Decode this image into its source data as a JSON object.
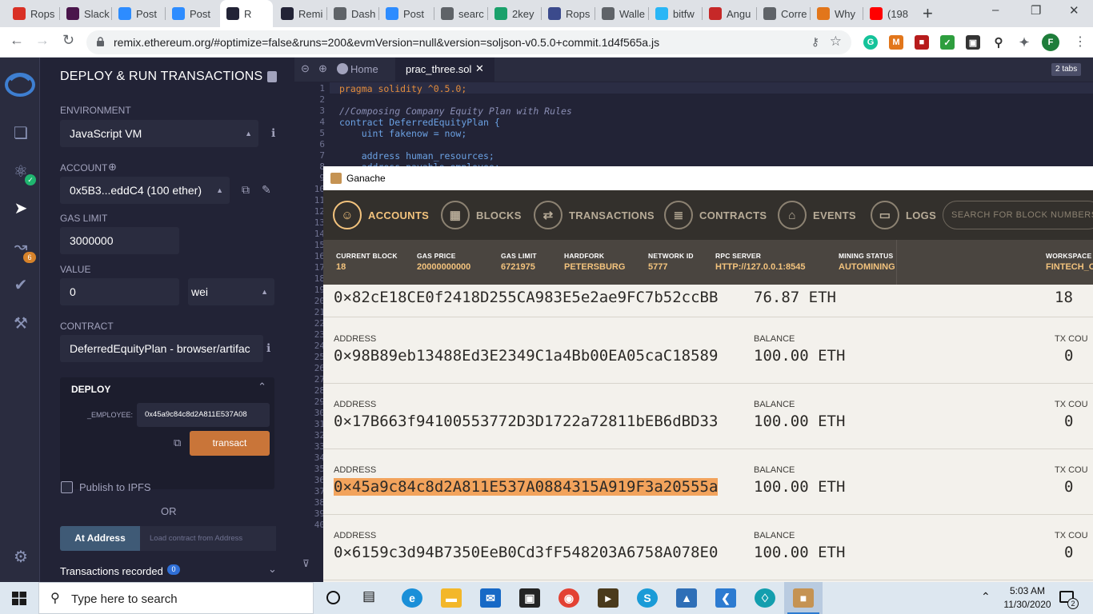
{
  "browser": {
    "tabs": [
      {
        "label": "Rops",
        "icon": "gmail-icon",
        "color": "#d93025"
      },
      {
        "label": "Slack",
        "icon": "slack-icon",
        "color": "#4a154b"
      },
      {
        "label": "Post",
        "icon": "zoom-icon",
        "color": "#2d8cff"
      },
      {
        "label": "Post",
        "icon": "zoom-icon",
        "color": "#2d8cff"
      },
      {
        "label": "R",
        "icon": "remix-icon",
        "color": "#222336"
      },
      {
        "label": "Remi",
        "icon": "remix-icon",
        "color": "#222336"
      },
      {
        "label": "Dash",
        "icon": "globe-icon",
        "color": "#5f6368"
      },
      {
        "label": "Post",
        "icon": "zoom-icon",
        "color": "#2d8cff"
      },
      {
        "label": "searc",
        "icon": "globe-icon",
        "color": "#5f6368"
      },
      {
        "label": "2key",
        "icon": "2key-icon",
        "color": "#1aa16b"
      },
      {
        "label": "Rops",
        "icon": "rops-icon",
        "color": "#3b4a8c"
      },
      {
        "label": "Walle",
        "icon": "globe-icon",
        "color": "#5f6368"
      },
      {
        "label": "bitfw",
        "icon": "ethereum-icon",
        "color": "#29b6f6"
      },
      {
        "label": "Angu",
        "icon": "pn-icon",
        "color": "#c62828"
      },
      {
        "label": "Corre",
        "icon": "dash-icon",
        "color": "#5f6368"
      },
      {
        "label": "Why",
        "icon": "metamask-icon",
        "color": "#e2761b"
      },
      {
        "label": "(198",
        "icon": "youtube-icon",
        "color": "#ff0000"
      }
    ],
    "url": "remix.ethereum.org/#optimize=false&runs=200&evmVersion=null&version=soljson-v0.5.0+commit.1d4f565a.js",
    "profile_initial": "F"
  },
  "remix": {
    "panel_title": "DEPLOY & RUN TRANSACTIONS",
    "environment_label": "ENVIRONMENT",
    "environment_value": "JavaScript VM",
    "account_label": "ACCOUNT",
    "account_value": "0x5B3...eddC4 (100 ether)",
    "gas_limit_label": "GAS LIMIT",
    "gas_limit_value": "3000000",
    "value_label": "VALUE",
    "value_amount": "0",
    "value_unit": "wei",
    "contract_label": "CONTRACT",
    "contract_value": "DeferredEquityPlan - browser/artifac",
    "deploy_label": "DEPLOY",
    "employee_label": "_EMPLOYEE:",
    "employee_value": "0x45a9c84c8d2A811E537A08",
    "transact_label": "transact",
    "publish_label": "Publish to IPFS",
    "or_label": "OR",
    "at_address_label": "At Address",
    "load_placeholder": "Load contract from Address",
    "transactions_recorded_label": "Transactions recorded",
    "transactions_recorded_count": "0",
    "analysis_badge": "6"
  },
  "editor": {
    "home_tab": "Home",
    "file_tab": "prac_three.sol",
    "tabs_badge": "2 tabs",
    "line_numbers": [
      "1",
      "2",
      "3",
      "4",
      "5",
      "6",
      "7",
      "8",
      "9",
      "10",
      "11",
      "12",
      "13",
      "14",
      "15",
      "16",
      "17",
      "18",
      "19",
      "20",
      "21",
      "22",
      "23",
      "24",
      "25",
      "26",
      "27",
      "28",
      "29",
      "30",
      "31",
      "32",
      "33",
      "34",
      "35",
      "36",
      "37",
      "38",
      "39",
      "40"
    ],
    "code_lines": [
      "pragma solidity ^0.5.0;",
      "",
      "//Composing Company Equity Plan with Rules",
      "contract DeferredEquityPlan {",
      "    uint fakenow = now;",
      "",
      "    address human_resources;",
      "    address payable employee;"
    ]
  },
  "ganache": {
    "window_title": "Ganache",
    "nav": [
      {
        "label": "ACCOUNTS",
        "icon": "accounts-icon",
        "active": true
      },
      {
        "label": "BLOCKS",
        "icon": "blocks-icon",
        "active": false
      },
      {
        "label": "TRANSACTIONS",
        "icon": "transactions-icon",
        "active": false
      },
      {
        "label": "CONTRACTS",
        "icon": "contracts-icon",
        "active": false
      },
      {
        "label": "EVENTS",
        "icon": "events-icon",
        "active": false
      },
      {
        "label": "LOGS",
        "icon": "logs-icon",
        "active": false
      }
    ],
    "search_placeholder": "SEARCH FOR BLOCK NUMBERS OR",
    "status": [
      {
        "label": "CURRENT BLOCK",
        "value": "18"
      },
      {
        "label": "GAS PRICE",
        "value": "20000000000"
      },
      {
        "label": "GAS LIMIT",
        "value": "6721975"
      },
      {
        "label": "HARDFORK",
        "value": "PETERSBURG"
      },
      {
        "label": "NETWORK ID",
        "value": "5777"
      },
      {
        "label": "RPC SERVER",
        "value": "HTTP://127.0.0.1:8545"
      },
      {
        "label": "MINING STATUS",
        "value": "AUTOMINING"
      },
      {
        "label": "WORKSPACE",
        "value": "FINTECH_O"
      }
    ],
    "partial_row": {
      "address": "0×82cE18CE0f2418D255CA983E5e2ae9FC7b52ccBB",
      "balance": "76.87 ETH",
      "tx_count": "18"
    },
    "address_header": "ADDRESS",
    "balance_header": "BALANCE",
    "tx_header": "TX COU",
    "accounts": [
      {
        "address": "0×98B89eb13488Ed3E2349C1a4Bb00EA05caC18589",
        "balance": "100.00 ETH",
        "tx_count": "0",
        "highlighted": false
      },
      {
        "address": "0×17B663f94100553772D3D1722a72811bEB6dBD33",
        "balance": "100.00 ETH",
        "tx_count": "0",
        "highlighted": false
      },
      {
        "address": "0×45a9c84c8d2A811E537A0884315A919F3a20555a",
        "balance": "100.00 ETH",
        "tx_count": "0",
        "highlighted": true
      },
      {
        "address": "0×6159c3d94B7350EeB0Cd3fF548203A6758A078E0",
        "balance": "100.00 ETH",
        "tx_count": "0",
        "highlighted": false
      }
    ]
  },
  "taskbar": {
    "search_placeholder": "Type here to search",
    "time": "5:03 AM",
    "date": "11/30/2020",
    "notification_count": "2"
  },
  "colors": {
    "remix_bg": "#222336",
    "remix_accent": "#c97539",
    "ganache_highlight": "#f2a35c",
    "ganache_status_value": "#f3c37d"
  }
}
